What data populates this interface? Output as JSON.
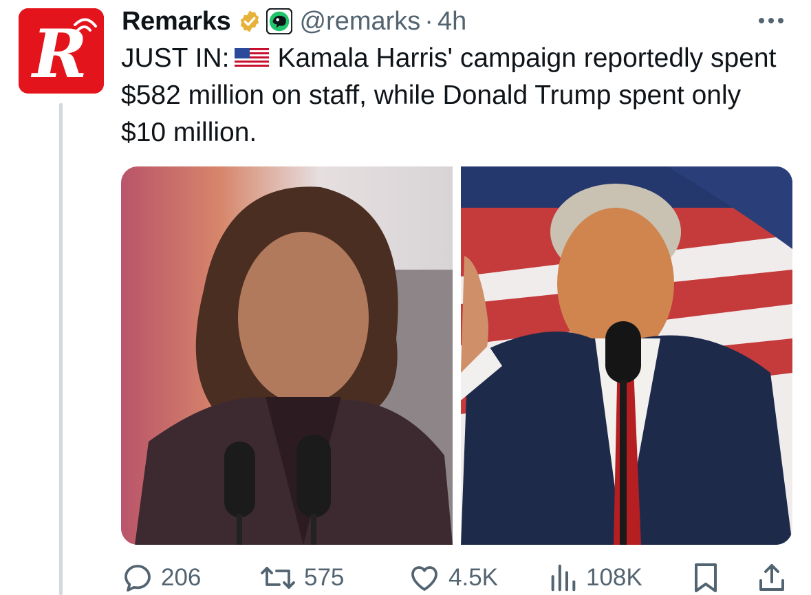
{
  "author": {
    "display_name": "Remarks",
    "handle": "@remarks",
    "separator": "·",
    "time": "4h",
    "avatar_logo": "R"
  },
  "tweet": {
    "prefix": "JUST IN:",
    "flag": "us-flag-emoji",
    "body": "Kamala Harris' campaign reportedly spent $582 million on staff, while Donald Trump spent only $10 million."
  },
  "media": {
    "count": 2,
    "left_photo": "harris-speaking-photo",
    "right_photo": "trump-speaking-photo"
  },
  "actions": {
    "replies": "206",
    "reposts": "575",
    "likes": "4.5K",
    "views": "108K"
  },
  "colors": {
    "text_primary": "#0f1419",
    "text_secondary": "#536471",
    "verified_gold": "#e8b23a",
    "avatar_red": "#e3141c",
    "thread_line": "#cfd9de"
  }
}
